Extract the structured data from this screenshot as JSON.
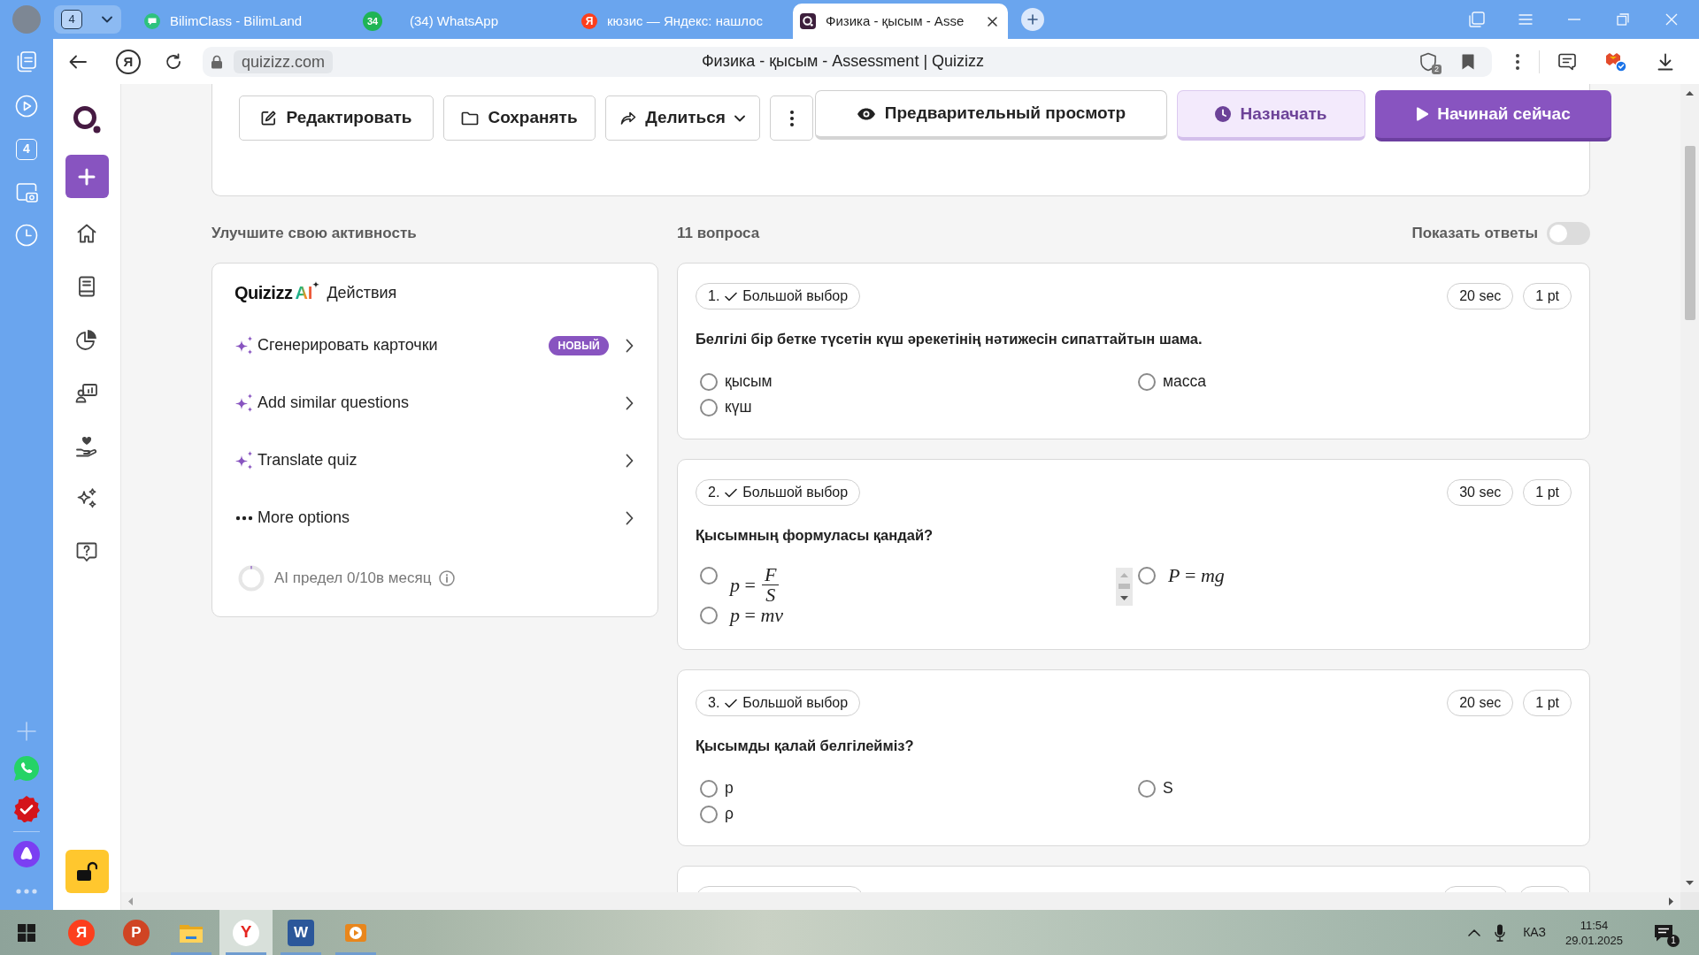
{
  "browser": {
    "tab_counter": "4",
    "tabs": [
      {
        "kind": "bilimclass",
        "title": "BilimClass - BilimLand",
        "selected": false
      },
      {
        "kind": "whatsapp",
        "badge": "34",
        "title": "(34) WhatsApp",
        "selected": false
      },
      {
        "kind": "yandex",
        "letter": "Я",
        "title": "кюзис — Яндекс: нашлос",
        "selected": false
      },
      {
        "kind": "quizizz",
        "title": "Физика - қысым - Asse",
        "selected": true
      }
    ],
    "toolbar": {
      "home_letter": "Я",
      "domain": "quizizz.com",
      "page_title": "Физика - қысым - Assessment | Quizizz",
      "shield_count": "2"
    },
    "side_panel": {
      "tab_count": "4"
    }
  },
  "header_actions": [
    {
      "kind": "edit",
      "label": "Редактировать"
    },
    {
      "kind": "save",
      "label": "Сохранять"
    },
    {
      "kind": "share",
      "label": "Делиться"
    },
    {
      "kind": "more"
    },
    {
      "kind": "preview",
      "label": "Предварительный просмотр"
    },
    {
      "kind": "assign",
      "label": "Назначать"
    },
    {
      "kind": "start",
      "label": "Начинай сейчас"
    }
  ],
  "improve": {
    "heading": "Улучшите свою активность",
    "brand": "Quizizz",
    "brand_ai": "AI",
    "title": "Действия",
    "actions": [
      {
        "kind": "ai",
        "label": "Сгенерировать карточки",
        "badge": "НОВЫЙ"
      },
      {
        "kind": "ai",
        "label": "Add similar questions"
      },
      {
        "kind": "ai",
        "label": "Translate quiz"
      },
      {
        "kind": "more",
        "label": "More options"
      }
    ],
    "limit": {
      "text": "AI предел 0/10в месяц"
    }
  },
  "questions": {
    "count": "11 вопроса",
    "show_answers": {
      "label": "Показать ответы",
      "on": false
    },
    "items": [
      {
        "number": "1.",
        "type": "Большой выбор",
        "time": "20 sec",
        "points": "1 pt",
        "text": "Белгілі бір бетке түсетін күш әрекетінің нәтижесін сипаттайтын шама.",
        "options": [
          {
            "kind": "text",
            "text": "қысым",
            "selected": false
          },
          {
            "kind": "text",
            "text": "масса",
            "selected": false
          },
          {
            "kind": "text",
            "text": "күш",
            "selected": false
          }
        ]
      },
      {
        "number": "2.",
        "type": "Большой выбор",
        "time": "30 sec",
        "points": "1 pt",
        "text": "Қысымның формуласы қандай?",
        "scroll_arrows": true,
        "options": [
          {
            "kind": "fraction",
            "left": "*p* =",
            "numerator": "F",
            "denominator": "S",
            "selected": false
          },
          {
            "kind": "formula",
            "text": "*P* = *mg*",
            "selected": false
          },
          {
            "kind": "formula",
            "text": "*p* = *mv*",
            "selected": false
          }
        ]
      },
      {
        "number": "3.",
        "type": "Большой выбор",
        "time": "20 sec",
        "points": "1 pt",
        "text": "Қысымды қалай белгілейміз?",
        "options": [
          {
            "kind": "text",
            "text": "p",
            "selected": false
          },
          {
            "kind": "text",
            "text": "S",
            "selected": false
          },
          {
            "kind": "text",
            "text": "ρ",
            "selected": false
          }
        ]
      }
    ]
  },
  "taskbar": {
    "apps": [
      {
        "kind": "start",
        "open": false,
        "selected": false
      },
      {
        "kind": "yandex",
        "letter": "Я",
        "open": false,
        "selected": false
      },
      {
        "kind": "powerpoint",
        "letter": "P",
        "open": false,
        "selected": false
      },
      {
        "kind": "explorer",
        "open": true,
        "selected": false
      },
      {
        "kind": "browser",
        "letter": "Y",
        "open": true,
        "selected": true
      },
      {
        "kind": "word",
        "letter": "W",
        "open": true,
        "selected": false
      },
      {
        "kind": "player",
        "open": true,
        "selected": false
      }
    ],
    "language": "КАЗ",
    "time": "11:54",
    "date": "29.01.2025",
    "notifications": "1"
  }
}
